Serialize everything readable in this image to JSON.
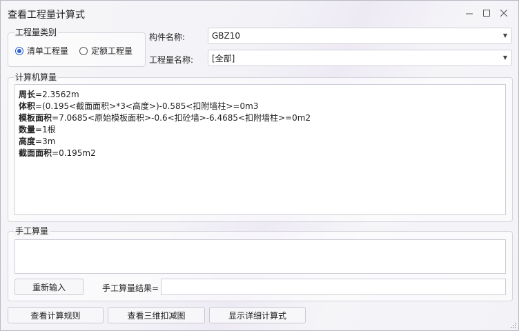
{
  "window": {
    "title": "查看工程量计算式",
    "controls": {
      "minimize": "–",
      "maximize": "□",
      "close": "✕"
    }
  },
  "qty_type": {
    "legend": "工程量类别",
    "options": [
      {
        "label": "清单工程量",
        "checked": true
      },
      {
        "label": "定额工程量",
        "checked": false
      }
    ]
  },
  "component": {
    "label": "构件名称:",
    "value": "GBZ10"
  },
  "qty_name": {
    "label": "工程量名称:",
    "value": "[全部]"
  },
  "computer_calc": {
    "legend": "计算机算量",
    "lines": [
      {
        "key": "周长",
        "expr": "=2.3562m"
      },
      {
        "key": "体积",
        "expr": "=(0.195<截面面积>*3<高度>)-0.585<扣附墙柱>=0m3"
      },
      {
        "key": "模板面积",
        "expr": "=7.0685<原始模板面积>-0.6<扣砼墙>-6.4685<扣附墙柱>=0m2"
      },
      {
        "key": "数量",
        "expr": "=1根"
      },
      {
        "key": "高度",
        "expr": "=3m"
      },
      {
        "key": "截面面积",
        "expr": "=0.195m2"
      }
    ]
  },
  "manual_calc": {
    "legend": "手工算量",
    "reenter_label": "重新输入",
    "result_label": "手工算量结果=",
    "result_value": ""
  },
  "footer": {
    "rules_label": "查看计算规则",
    "view3d_label": "查看三维扣减图",
    "detail_label": "显示详细计算式"
  },
  "colors": {
    "accent": "#2a5fd6"
  }
}
